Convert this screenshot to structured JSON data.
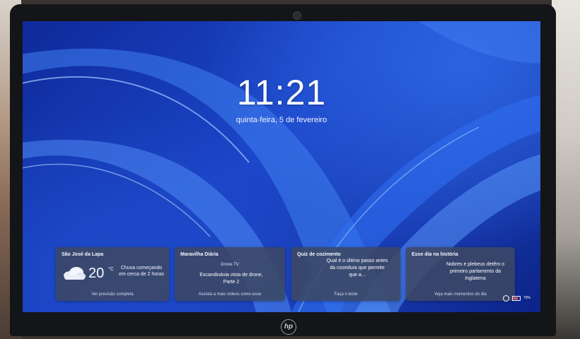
{
  "lockscreen": {
    "time": "11:21",
    "date": "quinta-feira, 5 de fevereiro"
  },
  "widgets": [
    {
      "title": "São José da Lapa",
      "temperature": "20",
      "unit": "°C",
      "description": "Chuva começando em cerca de 2 horas",
      "footer": "Ver previsão completa",
      "icon": "cloud-icon"
    },
    {
      "title": "Maravilha Diária",
      "source": "Drone TV",
      "body": "Escandinávia vista de drone, Parte 2",
      "footer": "Assista a mais vídeos como esse"
    },
    {
      "title": "Quiz de cozimento",
      "body": "Qual é o último passo antes da cozedura que permite que a...",
      "footer": "Faça o teste"
    },
    {
      "title": "Esse dia na história",
      "body": "Nobres e plebeus detêm o primeiro parlamento da Inglaterra",
      "footer": "Veja mais momentos do dia"
    }
  ],
  "tray": {
    "battery": "70%",
    "icons": [
      "network-icon",
      "battery-icon"
    ]
  },
  "device": {
    "logo": "hp"
  },
  "colors": {
    "wallpaper": "#1b46c9",
    "widget_bg": "#3c4864",
    "text": "#ffffff"
  }
}
